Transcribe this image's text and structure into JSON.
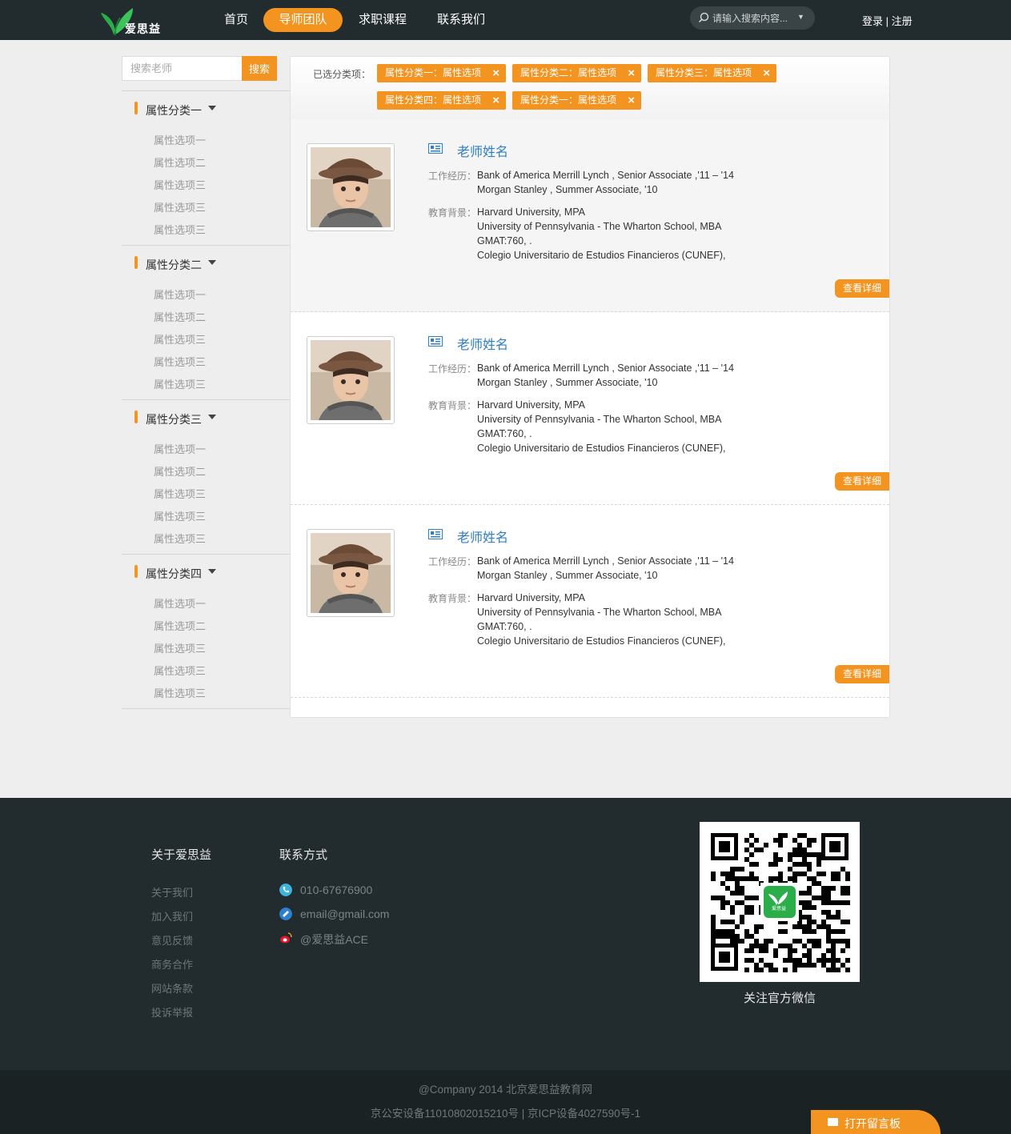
{
  "header": {
    "logo_text": "爱思益",
    "nav": [
      "首页",
      "导师团队",
      "求职课程",
      "联系我们"
    ],
    "search_placeholder": "请输入搜索内容...",
    "login": "登录",
    "separator": "|",
    "register": "注册"
  },
  "sidebar": {
    "search_placeholder": "搜索老师",
    "search_button": "搜索",
    "categories": [
      {
        "title": "属性分类一",
        "options": [
          "属性选项一",
          "属性选项二",
          "属性选项三",
          "属性选项三",
          "属性选项三"
        ]
      },
      {
        "title": "属性分类二",
        "options": [
          "属性选项一",
          "属性选项二",
          "属性选项三",
          "属性选项三",
          "属性选项三"
        ]
      },
      {
        "title": "属性分类三",
        "options": [
          "属性选项一",
          "属性选项二",
          "属性选项三",
          "属性选项三",
          "属性选项三"
        ]
      },
      {
        "title": "属性分类四",
        "options": [
          "属性选项一",
          "属性选项二",
          "属性选项三",
          "属性选项三",
          "属性选项三"
        ]
      }
    ]
  },
  "filters": {
    "label": "已选分类项：",
    "tags": [
      "属性分类一：属性选项",
      "属性分类二：属性选项",
      "属性分类三：属性选项",
      "属性分类四：属性选项",
      "属性分类一：属性选项"
    ],
    "remove_glyph": "×"
  },
  "teachers": [
    {
      "name": "老师姓名",
      "work_label": "工作经历：",
      "work": [
        "Bank of America Merrill Lynch , Senior Associate ,'11 – '14",
        "Morgan Stanley , Summer Associate, '10"
      ],
      "edu_label": "教育背景：",
      "edu": [
        "Harvard University, MPA",
        "University of Pennsylvania - The Wharton School, MBA",
        "GMAT:760, .",
        "Colegio Universitario de Estudios Financieros (CUNEF),"
      ],
      "detail_button": "查看详细"
    },
    {
      "name": "老师姓名",
      "work_label": "工作经历：",
      "work": [
        "Bank of America Merrill Lynch , Senior Associate ,'11 – '14",
        "Morgan Stanley , Summer Associate, '10"
      ],
      "edu_label": "教育背景：",
      "edu": [
        "Harvard University, MPA",
        "University of Pennsylvania - The Wharton School, MBA",
        "GMAT:760, .",
        "Colegio Universitario de Estudios Financieros (CUNEF),"
      ],
      "detail_button": "查看详细"
    },
    {
      "name": "老师姓名",
      "work_label": "工作经历：",
      "work": [
        "Bank of America Merrill Lynch , Senior Associate ,'11 – '14",
        "Morgan Stanley , Summer Associate, '10"
      ],
      "edu_label": "教育背景：",
      "edu": [
        "Harvard University, MPA",
        "University of Pennsylvania - The Wharton School, MBA",
        "GMAT:760, .",
        "Colegio Universitario de Estudios Financieros (CUNEF),"
      ],
      "detail_button": "查看详细"
    }
  ],
  "footer": {
    "about_title": "关于爱思益",
    "about_links": [
      "关于我们",
      "加入我们",
      "意见反馈",
      "商务合作",
      "网站条款",
      "投诉举报"
    ],
    "contact_title": "联系方式",
    "contacts": [
      {
        "icon": "phone-icon",
        "text": "010-67676900"
      },
      {
        "icon": "email-icon",
        "text": "email@gmail.com"
      },
      {
        "icon": "weibo-icon",
        "text": "@爱思益ACE"
      }
    ],
    "qr_caption": "关注官方微信",
    "qr_logo_text": "爱思益",
    "copyright": "@Company 2014 北京爱思益教育网",
    "icp": "京公安设备11010802015210号 | 京ICP设备4027590号-1"
  },
  "message_board": "打开留言板",
  "colors": {
    "accent": "#f39421",
    "header_bg": "#222b2d",
    "link_blue": "#2f7fc1",
    "brand_green": "#2bae4a"
  }
}
